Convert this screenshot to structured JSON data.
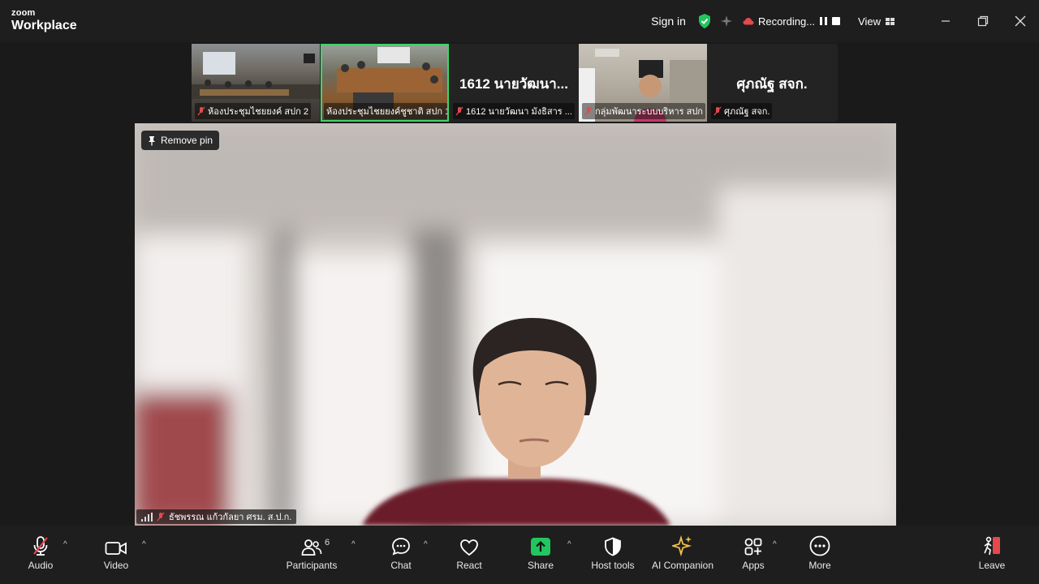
{
  "app": {
    "brand_small": "zoom",
    "brand_large": "Workplace"
  },
  "titlebar": {
    "sign_in": "Sign in",
    "recording": "Recording...",
    "view": "View"
  },
  "participants_strip": [
    {
      "name": "ห้องประชุมไชยยงค์ สปก 2",
      "muted": true,
      "active": false
    },
    {
      "name": "ห้องประชุมไชยยงค์ชูชาติ สปก 1",
      "muted": false,
      "active": true
    },
    {
      "display": "1612 นายวัฒนา...",
      "name": "1612 นายวัฒนา มังธิสาร ...",
      "muted": true,
      "active": false
    },
    {
      "name": "กลุ่มพัฒนาระบบบริหาร สปก",
      "muted": true,
      "active": false
    },
    {
      "display": "ศุภณัฐ สจก.",
      "name": "ศุภณัฐ สจก.",
      "muted": true,
      "active": false
    }
  ],
  "stage": {
    "remove_pin": "Remove pin",
    "speaker_name": "ธัชพรรณ แก้วกัลยา ศรม. ส.ป.ก."
  },
  "toolbar": {
    "audio": "Audio",
    "video": "Video",
    "participants": "Participants",
    "participants_count": "6",
    "chat": "Chat",
    "react": "React",
    "share": "Share",
    "host_tools": "Host tools",
    "ai_companion": "AI Companion",
    "apps": "Apps",
    "more": "More",
    "leave": "Leave"
  },
  "colors": {
    "accent_green": "#3fd46a",
    "share_green": "#22c55e",
    "muted_red": "#e5484d",
    "ai_gold": "#f3c04a"
  }
}
